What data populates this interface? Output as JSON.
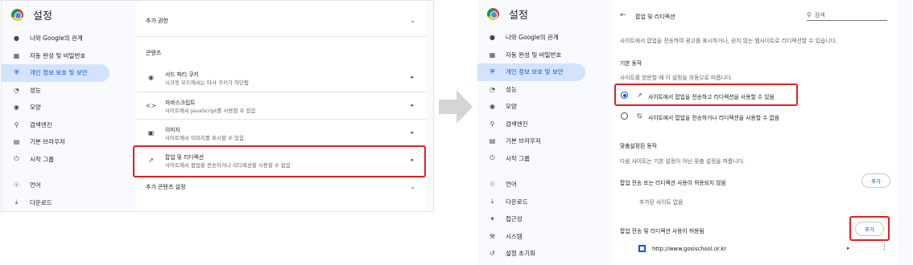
{
  "left": {
    "brand": {
      "title": "설정",
      "icon": "chrome-logo-icon"
    },
    "nav": [
      {
        "label": "나와 Google의 관계",
        "icon": "person-icon"
      },
      {
        "label": "자동 완성 및 비밀번호",
        "icon": "clipboard-icon"
      },
      {
        "label": "개인 정보 보호 및 보안",
        "icon": "shield-icon",
        "active": true
      },
      {
        "label": "성능",
        "icon": "speedometer-icon"
      },
      {
        "label": "모양",
        "icon": "palette-icon"
      },
      {
        "label": "검색엔진",
        "icon": "search-icon"
      },
      {
        "label": "기본 브라우저",
        "icon": "browser-icon"
      },
      {
        "label": "시작 그룹",
        "icon": "power-icon"
      },
      {
        "label": "언어",
        "icon": "globe-icon"
      },
      {
        "label": "다운로드",
        "icon": "download-icon"
      }
    ],
    "content": {
      "additional_permissions": "추가 권한",
      "section_title": "콘텐츠",
      "rows": [
        {
          "title": "서드 파티 쿠키",
          "subtitle": "시크릿 모드에서는 타사 쿠키가 차단됨",
          "icon": "cookie-icon"
        },
        {
          "title": "자바스크립트",
          "subtitle": "사이트에서 JavaScript를 사용할 수 있음",
          "icon": "code-icon"
        },
        {
          "title": "이미지",
          "subtitle": "사이트에서 이미지를 표시할 수 있음",
          "icon": "image-icon"
        },
        {
          "title": "팝업 및 리디렉션",
          "subtitle": "사이트에서 팝업을 전송하거나 리디렉션을 사용할 수 없음",
          "icon": "popup-icon"
        }
      ],
      "additional_content_settings": "추가 콘텐츠 설정"
    }
  },
  "right": {
    "brand": {
      "title": "설정",
      "icon": "chrome-logo-icon"
    },
    "nav": [
      {
        "label": "나와 Google의 관계",
        "icon": "person-icon"
      },
      {
        "label": "자동 완성 및 비밀번호",
        "icon": "clipboard-icon"
      },
      {
        "label": "개인 정보 보호 및 보안",
        "icon": "shield-icon",
        "active": true
      },
      {
        "label": "성능",
        "icon": "speedometer-icon"
      },
      {
        "label": "모양",
        "icon": "palette-icon"
      },
      {
        "label": "검색엔진",
        "icon": "search-icon"
      },
      {
        "label": "기본 브라우저",
        "icon": "browser-icon"
      },
      {
        "label": "시작 그룹",
        "icon": "power-icon"
      },
      {
        "label": "언어",
        "icon": "globe-icon"
      },
      {
        "label": "다운로드",
        "icon": "download-icon"
      },
      {
        "label": "접근성",
        "icon": "accessibility-icon"
      },
      {
        "label": "시스템",
        "icon": "wrench-icon"
      },
      {
        "label": "설정 초기화",
        "icon": "reset-icon"
      }
    ],
    "content": {
      "page_title": "팝업 및 리디렉션",
      "search_placeholder": "검색",
      "description": "사이트에서 팝업을 전송하여 광고를 표시하거나, 원치 않는 웹사이트로 리디렉션할 수 있습니다.",
      "default_behavior_title": "기본 동작",
      "default_behavior_sub": "사이트를 방문할 때 이 설정을 자동으로 따릅니다.",
      "option_allow": "사이트에서 팝업을 전송하고 리디렉션을 사용할 수 있음",
      "option_block": "사이트에서 팝업을 전송하거나 리디렉션을 사용할 수 없음",
      "selected_option": "allow",
      "custom_title": "맞춤설정된 동작",
      "custom_sub": "다음 사이트는 기본 설정이 아닌 맞춤 설정을 따릅니다.",
      "not_allowed_title": "팝업 전송 또는 리디렉션 사용이 허용되지 않음",
      "no_sites": "추가된 사이트 없음",
      "allowed_title": "팝업 전송 및 리디렉션 사용이 허용됨",
      "add_label": "추가",
      "site_url": "http://www.gosischool.or.kr"
    }
  },
  "colors": {
    "accent": "#0b57d0",
    "active_nav_bg": "#d3e3fd",
    "highlight": "#e02020",
    "sidebar_bg": "#f8fafd"
  }
}
